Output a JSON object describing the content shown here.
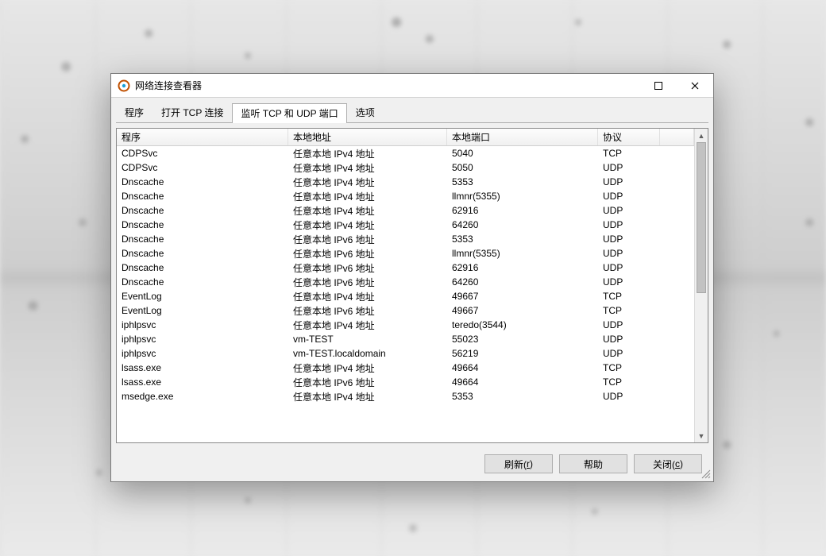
{
  "window": {
    "title": "网络连接查看器"
  },
  "tabs": {
    "items": [
      {
        "label": "程序"
      },
      {
        "label": "打开 TCP 连接"
      },
      {
        "label": "监听 TCP 和 UDP 端口"
      },
      {
        "label": "选项"
      }
    ],
    "active_index": 2
  },
  "listview": {
    "columns": [
      {
        "label": "程序"
      },
      {
        "label": "本地地址"
      },
      {
        "label": "本地端口"
      },
      {
        "label": "协议"
      }
    ],
    "rows": [
      {
        "c": [
          "CDPSvc",
          "任意本地 IPv4 地址",
          "5040",
          "TCP"
        ]
      },
      {
        "c": [
          "CDPSvc",
          "任意本地 IPv4 地址",
          "5050",
          "UDP"
        ]
      },
      {
        "c": [
          "Dnscache",
          "任意本地 IPv4 地址",
          "5353",
          "UDP"
        ]
      },
      {
        "c": [
          "Dnscache",
          "任意本地 IPv4 地址",
          "llmnr(5355)",
          "UDP"
        ]
      },
      {
        "c": [
          "Dnscache",
          "任意本地 IPv4 地址",
          "62916",
          "UDP"
        ]
      },
      {
        "c": [
          "Dnscache",
          "任意本地 IPv4 地址",
          "64260",
          "UDP"
        ]
      },
      {
        "c": [
          "Dnscache",
          "任意本地 IPv6 地址",
          "5353",
          "UDP"
        ]
      },
      {
        "c": [
          "Dnscache",
          "任意本地 IPv6 地址",
          "llmnr(5355)",
          "UDP"
        ]
      },
      {
        "c": [
          "Dnscache",
          "任意本地 IPv6 地址",
          "62916",
          "UDP"
        ]
      },
      {
        "c": [
          "Dnscache",
          "任意本地 IPv6 地址",
          "64260",
          "UDP"
        ]
      },
      {
        "c": [
          "EventLog",
          "任意本地 IPv4 地址",
          "49667",
          "TCP"
        ]
      },
      {
        "c": [
          "EventLog",
          "任意本地 IPv6 地址",
          "49667",
          "TCP"
        ]
      },
      {
        "c": [
          "iphlpsvc",
          "任意本地 IPv4 地址",
          "teredo(3544)",
          "UDP"
        ]
      },
      {
        "c": [
          "iphlpsvc",
          "vm-TEST",
          "55023",
          "UDP"
        ]
      },
      {
        "c": [
          "iphlpsvc",
          "vm-TEST.localdomain",
          "56219",
          "UDP"
        ]
      },
      {
        "c": [
          "lsass.exe",
          "任意本地 IPv4 地址",
          "49664",
          "TCP"
        ]
      },
      {
        "c": [
          "lsass.exe",
          "任意本地 IPv6 地址",
          "49664",
          "TCP"
        ]
      },
      {
        "c": [
          "msedge.exe",
          "任意本地 IPv4 地址",
          "5353",
          "UDP"
        ]
      }
    ]
  },
  "buttons": {
    "refresh": {
      "prefix": "刷新(",
      "hotkey": "r",
      "suffix": ")"
    },
    "help": {
      "label": "帮助"
    },
    "close": {
      "prefix": "关闭(",
      "hotkey": "c",
      "suffix": ")"
    }
  }
}
